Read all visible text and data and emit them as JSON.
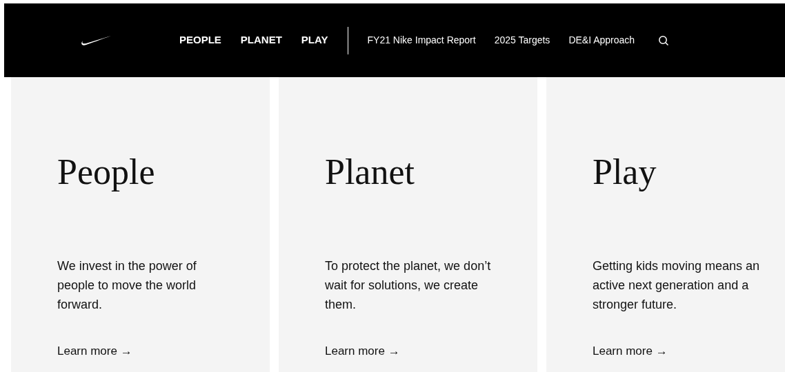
{
  "nav": {
    "primary": [
      "PEOPLE",
      "PLANET",
      "PLAY"
    ],
    "secondary": [
      "FY21 Nike Impact Report",
      "2025 Targets",
      "DE&I Approach"
    ]
  },
  "cards": [
    {
      "title": "People",
      "text": "We invest in the power of people to move the world forward.",
      "link": "Learn more →"
    },
    {
      "title": "Planet",
      "text": "To protect the planet, we don’t wait for solutions, we create them.",
      "link": "Learn more →"
    },
    {
      "title": "Play",
      "text": "Getting kids moving means an active next generation and a stronger future.",
      "link": "Learn more →"
    }
  ]
}
